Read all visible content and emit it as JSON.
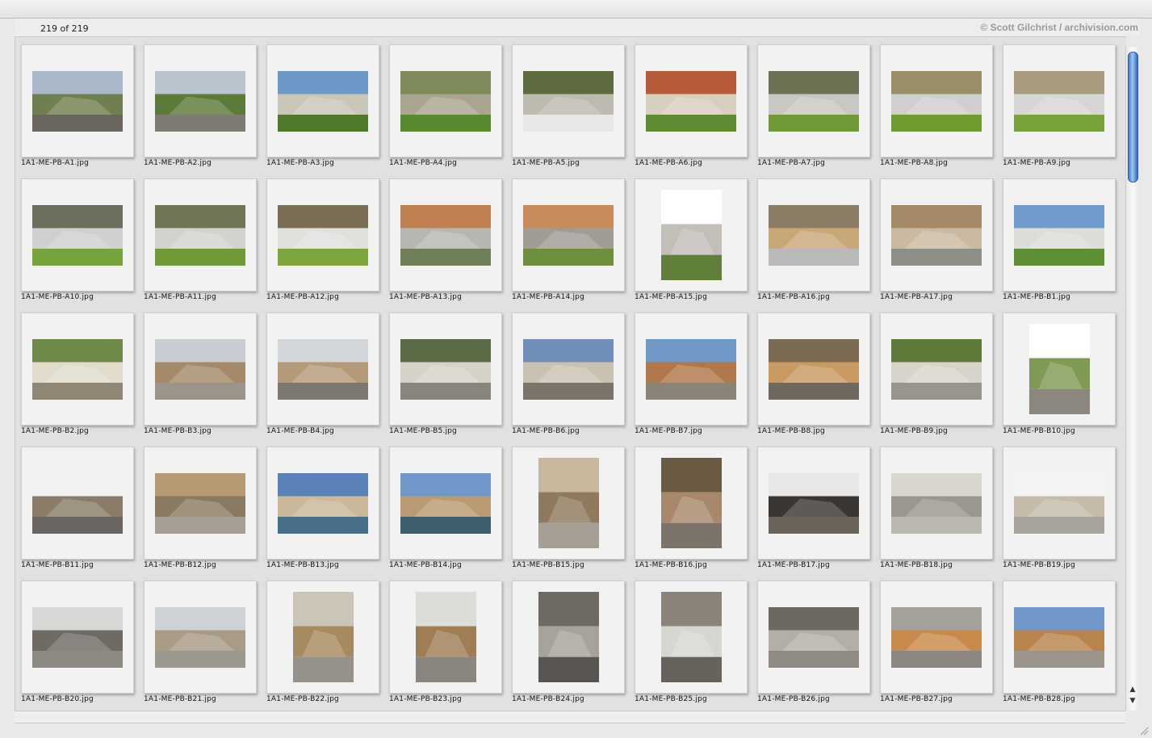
{
  "header": {
    "count": "219 of 219",
    "credit": "© Scott Gilchrist / archivision.com"
  },
  "icons": {
    "scroll_up": "scroll-up-arrow-icon",
    "scroll_down": "scroll-down-arrow-icon",
    "resize": "resize-grip-icon"
  },
  "thumbnails": [
    {
      "name": "1A1-ME-PB-A1.jpg",
      "orientation": "landscape",
      "sky": "#aab9c9",
      "mid": "#6f7f4f",
      "ground": "#6a655e"
    },
    {
      "name": "1A1-ME-PB-A2.jpg",
      "orientation": "landscape",
      "sky": "#b9c4cf",
      "mid": "#5c7a3a",
      "ground": "#7f7a72"
    },
    {
      "name": "1A1-ME-PB-A3.jpg",
      "orientation": "landscape",
      "sky": "#6b98c7",
      "mid": "#c9c6b8",
      "ground": "#4f7a2c"
    },
    {
      "name": "1A1-ME-PB-A4.jpg",
      "orientation": "landscape",
      "sky": "#7f8a5a",
      "mid": "#a9a58e",
      "ground": "#5a8a30"
    },
    {
      "name": "1A1-ME-PB-A5.jpg",
      "orientation": "landscape",
      "sky": "#5d6b3e",
      "mid": "#bfbab0",
      "ground": "#e6e8ea"
    },
    {
      "name": "1A1-ME-PB-A6.jpg",
      "orientation": "landscape",
      "sky": "#b65c3a",
      "mid": "#d8d0bf",
      "ground": "#5f8c33"
    },
    {
      "name": "1A1-ME-PB-A7.jpg",
      "orientation": "landscape",
      "sky": "#6c7253",
      "mid": "#c9c7c2",
      "ground": "#6f9a36"
    },
    {
      "name": "1A1-ME-PB-A8.jpg",
      "orientation": "landscape",
      "sky": "#9b8f6a",
      "mid": "#cfcfcf",
      "ground": "#6f9a30"
    },
    {
      "name": "1A1-ME-PB-A9.jpg",
      "orientation": "landscape",
      "sky": "#a79c80",
      "mid": "#d6d6d4",
      "ground": "#77a13a"
    },
    {
      "name": "1A1-ME-PB-A10.jpg",
      "orientation": "landscape",
      "sky": "#6b6f5e",
      "mid": "#cfd0cf",
      "ground": "#76a33c"
    },
    {
      "name": "1A1-ME-PB-A11.jpg",
      "orientation": "landscape",
      "sky": "#6f7655",
      "mid": "#d2d2cf",
      "ground": "#6f9a35"
    },
    {
      "name": "1A1-ME-PB-A12.jpg",
      "orientation": "landscape",
      "sky": "#7a6e55",
      "mid": "#e0e0dd",
      "ground": "#7ea43e"
    },
    {
      "name": "1A1-ME-PB-A13.jpg",
      "orientation": "landscape",
      "sky": "#c08050",
      "mid": "#b8b6b1",
      "ground": "#6f7f58"
    },
    {
      "name": "1A1-ME-PB-A14.jpg",
      "orientation": "landscape",
      "sky": "#c98a5c",
      "mid": "#9f9c95",
      "ground": "#6f8f3f"
    },
    {
      "name": "1A1-ME-PB-A15.jpg",
      "orientation": "portrait",
      "sky": "#ffffff",
      "mid": "#c2bfb9",
      "ground": "#5f7f3a"
    },
    {
      "name": "1A1-ME-PB-A16.jpg",
      "orientation": "landscape",
      "sky": "#8b7c66",
      "mid": "#c8a878",
      "ground": "#b9b9b7"
    },
    {
      "name": "1A1-ME-PB-A17.jpg",
      "orientation": "landscape",
      "sky": "#a58a68",
      "mid": "#cbbaa2",
      "ground": "#8f8f8a"
    },
    {
      "name": "1A1-ME-PB-B1.jpg",
      "orientation": "landscape",
      "sky": "#6f9ccc",
      "mid": "#dcdcd8",
      "ground": "#5f8f35"
    },
    {
      "name": "1A1-ME-PB-B2.jpg",
      "orientation": "landscape",
      "sky": "#6f8a4a",
      "mid": "#e2dccd",
      "ground": "#8f8676"
    },
    {
      "name": "1A1-ME-PB-B3.jpg",
      "orientation": "landscape",
      "sky": "#c7cdd3",
      "mid": "#a58a6a",
      "ground": "#9c948a"
    },
    {
      "name": "1A1-ME-PB-B4.jpg",
      "orientation": "landscape",
      "sky": "#d2d6da",
      "mid": "#b59a7a",
      "ground": "#7c7870"
    },
    {
      "name": "1A1-ME-PB-B5.jpg",
      "orientation": "landscape",
      "sky": "#5a6b45",
      "mid": "#d6d2c8",
      "ground": "#8a857c"
    },
    {
      "name": "1A1-ME-PB-B6.jpg",
      "orientation": "landscape",
      "sky": "#6f8fb8",
      "mid": "#c9c2b2",
      "ground": "#7a746a"
    },
    {
      "name": "1A1-ME-PB-B7.jpg",
      "orientation": "landscape",
      "sky": "#6f98c6",
      "mid": "#b0784a",
      "ground": "#8a8478"
    },
    {
      "name": "1A1-ME-PB-B8.jpg",
      "orientation": "landscape",
      "sky": "#7a6a52",
      "mid": "#c89a62",
      "ground": "#6e685e"
    },
    {
      "name": "1A1-ME-PB-B9.jpg",
      "orientation": "landscape",
      "sky": "#5e7a3a",
      "mid": "#d8d4cc",
      "ground": "#9a958c"
    },
    {
      "name": "1A1-ME-PB-B10.jpg",
      "orientation": "portrait",
      "sky": "#ffffff",
      "mid": "#7f9a55",
      "ground": "#8c877e"
    },
    {
      "name": "1A1-ME-PB-B11.jpg",
      "orientation": "landscape",
      "sky": "#f2f2f2",
      "mid": "#8a7c66",
      "ground": "#6a6560"
    },
    {
      "name": "1A1-ME-PB-B12.jpg",
      "orientation": "landscape",
      "sky": "#b89a72",
      "mid": "#8a7a62",
      "ground": "#a59e92"
    },
    {
      "name": "1A1-ME-PB-B13.jpg",
      "orientation": "landscape",
      "sky": "#5a82b8",
      "mid": "#c9b89a",
      "ground": "#4a6f8a"
    },
    {
      "name": "1A1-ME-PB-B14.jpg",
      "orientation": "landscape",
      "sky": "#6f98c8",
      "mid": "#b99a72",
      "ground": "#3f5f6f"
    },
    {
      "name": "1A1-ME-PB-B15.jpg",
      "orientation": "portrait",
      "sky": "#c8b79c",
      "mid": "#8f7a5e",
      "ground": "#a69f94"
    },
    {
      "name": "1A1-ME-PB-B16.jpg",
      "orientation": "portrait",
      "sky": "#6a5a44",
      "mid": "#a8886a",
      "ground": "#7c7468"
    },
    {
      "name": "1A1-ME-PB-B17.jpg",
      "orientation": "landscape",
      "sky": "#e8e8e8",
      "mid": "#3a3633",
      "ground": "#6a635a"
    },
    {
      "name": "1A1-ME-PB-B18.jpg",
      "orientation": "landscape",
      "sky": "#d9d6cf",
      "mid": "#9c978e",
      "ground": "#bcb8b0"
    },
    {
      "name": "1A1-ME-PB-B19.jpg",
      "orientation": "landscape",
      "sky": "#f4f4f2",
      "mid": "#c5bba8",
      "ground": "#a9a49b"
    },
    {
      "name": "1A1-ME-PB-B20.jpg",
      "orientation": "landscape",
      "sky": "#d7d7d5",
      "mid": "#6f6a63",
      "ground": "#8d8983"
    },
    {
      "name": "1A1-ME-PB-B21.jpg",
      "orientation": "landscape",
      "sky": "#cfd2d4",
      "mid": "#a99c86",
      "ground": "#9c9890"
    },
    {
      "name": "1A1-ME-PB-B22.jpg",
      "orientation": "portrait",
      "sky": "#cbc5b8",
      "mid": "#a88a60",
      "ground": "#96918a"
    },
    {
      "name": "1A1-ME-PB-B23.jpg",
      "orientation": "portrait",
      "sky": "#dcdcd8",
      "mid": "#9f7e56",
      "ground": "#8a867f"
    },
    {
      "name": "1A1-ME-PB-B24.jpg",
      "orientation": "portrait",
      "sky": "#6e6a63",
      "mid": "#a7a39b",
      "ground": "#595550"
    },
    {
      "name": "1A1-ME-PB-B25.jpg",
      "orientation": "portrait",
      "sky": "#8c8378",
      "mid": "#d8d6d0",
      "ground": "#66625c"
    },
    {
      "name": "1A1-ME-PB-B26.jpg",
      "orientation": "landscape",
      "sky": "#6c6963",
      "mid": "#b3afa7",
      "ground": "#8f8b84"
    },
    {
      "name": "1A1-ME-PB-B27.jpg",
      "orientation": "landscape",
      "sky": "#a5a19a",
      "mid": "#c88a4a",
      "ground": "#8c8781"
    },
    {
      "name": "1A1-ME-PB-B28.jpg",
      "orientation": "landscape",
      "sky": "#6f98c8",
      "mid": "#b7844e",
      "ground": "#9a948b"
    }
  ]
}
